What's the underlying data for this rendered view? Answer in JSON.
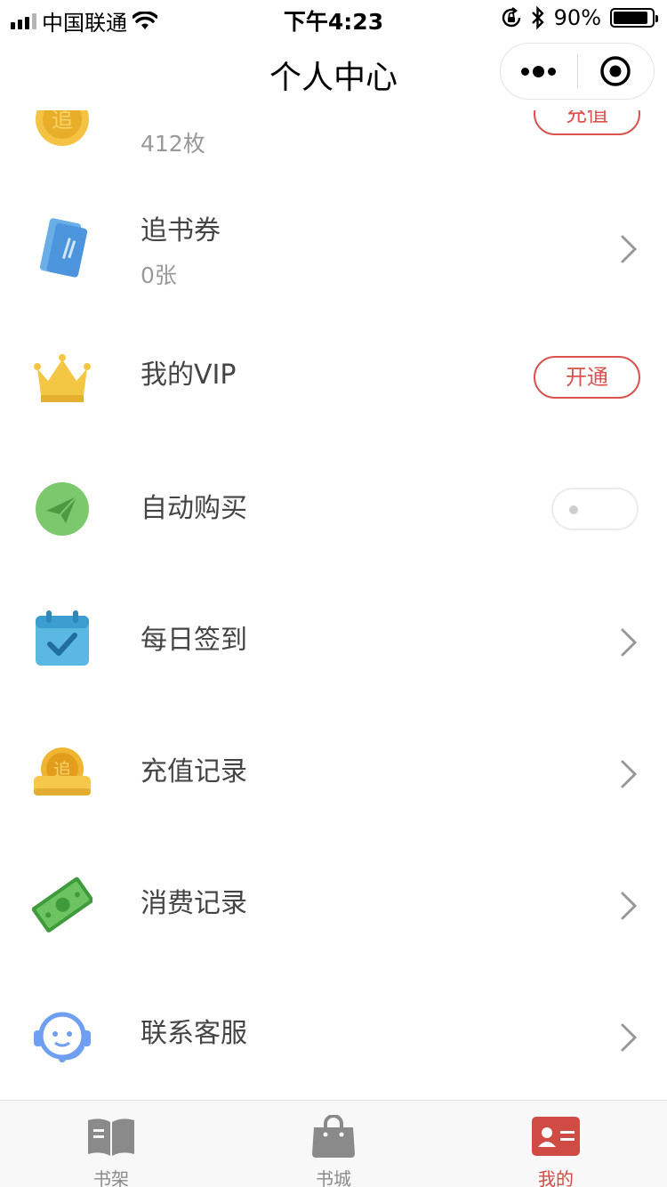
{
  "status_bar": {
    "carrier": "中国联通",
    "time": "下午4:23",
    "battery": "90%",
    "battery_level": 0.9
  },
  "nav": {
    "title": "个人中心"
  },
  "items": [
    {
      "icon": "gold-coin-icon",
      "title": "",
      "subtitle": "412枚",
      "action": "pill",
      "action_label": "充值"
    },
    {
      "icon": "ticket-icon",
      "title": "追书券",
      "subtitle": "0张",
      "action": "chevron"
    },
    {
      "icon": "crown-icon",
      "title": "我的VIP",
      "action": "pill",
      "action_label": "开通"
    },
    {
      "icon": "paper-plane-icon",
      "title": "自动购买",
      "action": "toggle",
      "toggle_on": false
    },
    {
      "icon": "calendar-check-icon",
      "title": "每日签到",
      "action": "chevron"
    },
    {
      "icon": "coin-stack-icon",
      "title": "充值记录",
      "action": "chevron"
    },
    {
      "icon": "money-bill-icon",
      "title": "消费记录",
      "action": "chevron"
    },
    {
      "icon": "headset-icon",
      "title": "联系客服",
      "action": "chevron"
    }
  ],
  "coin_glyph": "追",
  "tabs": [
    {
      "label": "书架",
      "icon": "open-book-icon",
      "active": false
    },
    {
      "label": "书城",
      "icon": "shopping-bag-icon",
      "active": false
    },
    {
      "label": "我的",
      "icon": "profile-card-icon",
      "active": true
    }
  ],
  "colors": {
    "accent": "#d04b43",
    "tab_inactive": "#8a8a8a",
    "text_secondary": "#999999"
  }
}
